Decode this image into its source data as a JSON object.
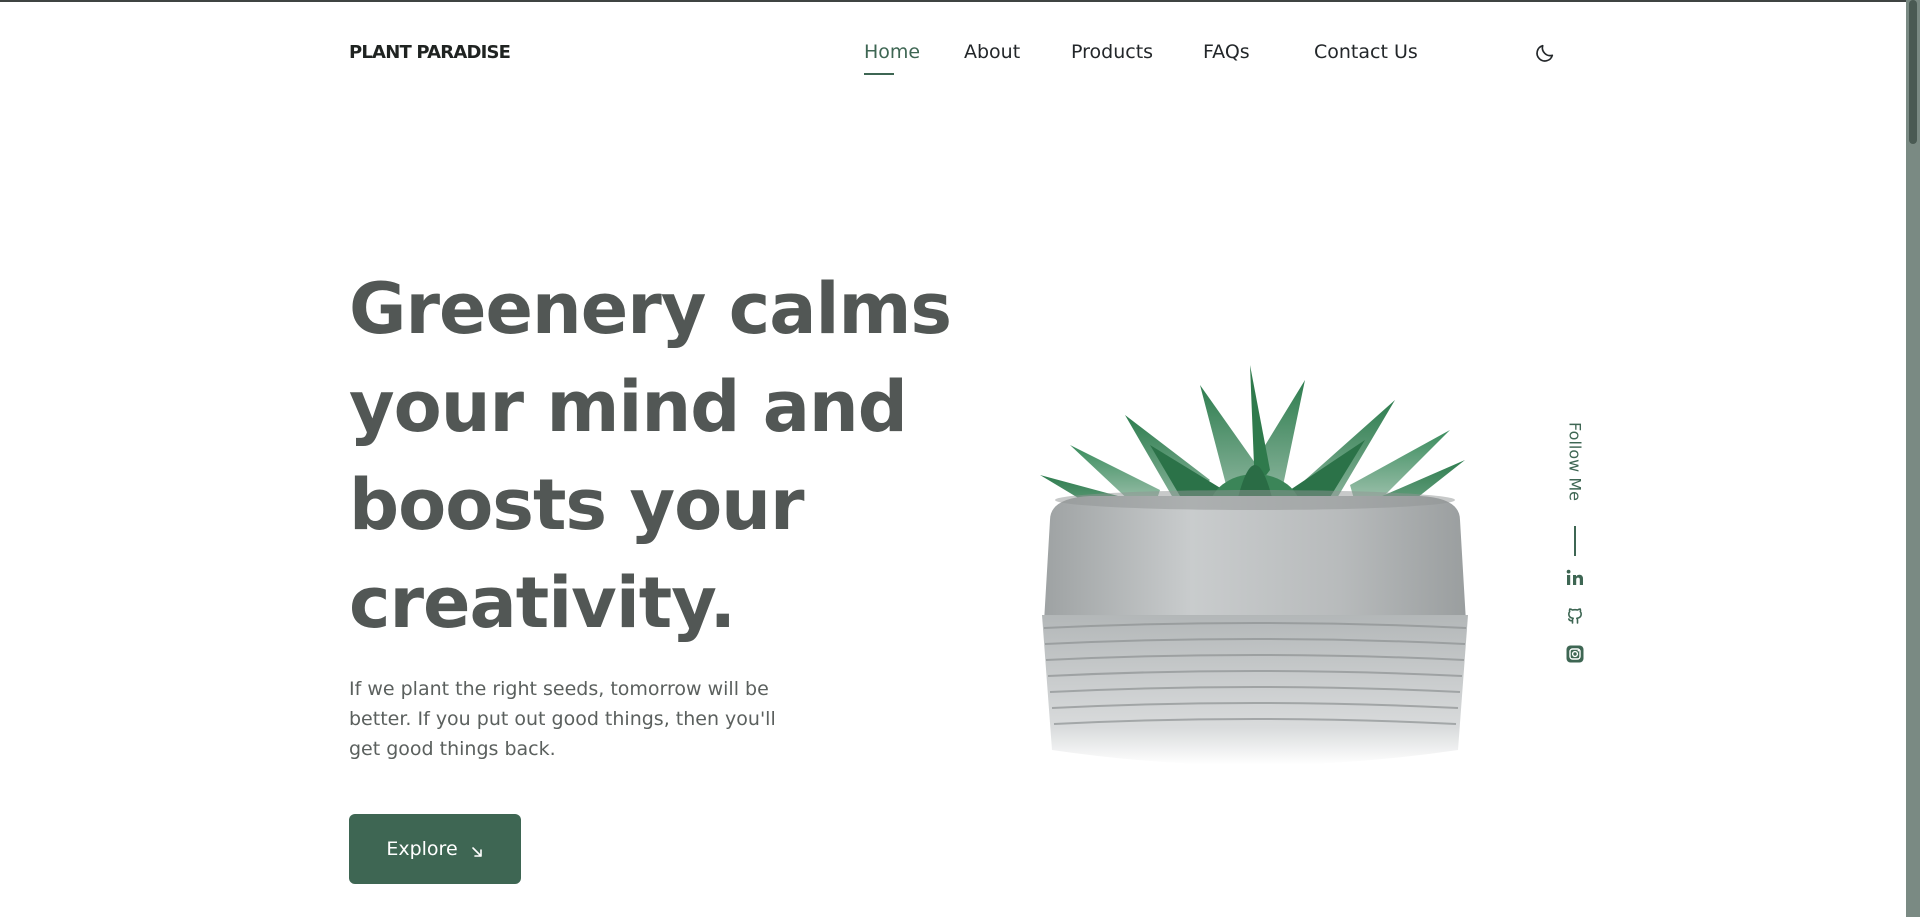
{
  "header": {
    "logo": "PLANT PARADISE",
    "nav": [
      {
        "label": "Home",
        "active": true
      },
      {
        "label": "About",
        "active": false
      },
      {
        "label": "Products",
        "active": false
      },
      {
        "label": "FAQs",
        "active": false
      },
      {
        "label": "Contact Us",
        "active": false
      }
    ],
    "theme_icon": "moon-icon"
  },
  "hero": {
    "title_lines": [
      "Greenery calms",
      "your mind and",
      "boosts your",
      "creativity."
    ],
    "text": "If we plant the right seeds, tomorrow will be better. If you put out good things, then you'll get good things back.",
    "button_label": "Explore",
    "button_icon": "arrow-down-right-icon"
  },
  "social": {
    "label": "Follow Me",
    "icons": [
      "linkedin-icon",
      "github-icon",
      "instagram-icon"
    ]
  },
  "colors": {
    "accent": "#3e6653",
    "heading": "#525755",
    "text": "#5b605e",
    "background": "#ffffff"
  }
}
